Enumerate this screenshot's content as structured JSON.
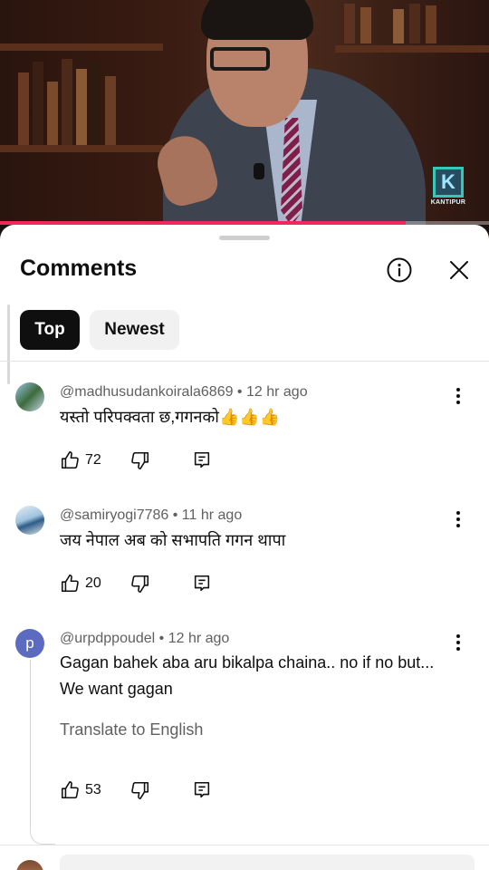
{
  "video": {
    "channel_logo_text": "KANTIPUR",
    "progress_fraction": 0.83
  },
  "sheet": {
    "title": "Comments",
    "filters": [
      {
        "label": "Top",
        "selected": true
      },
      {
        "label": "Newest",
        "selected": false
      }
    ]
  },
  "comments": [
    {
      "author": "@madhusudankoirala6869",
      "time": "12 hr ago",
      "meta": "@madhusudankoirala6869 • 12 hr ago",
      "text": "यस्तो परिपक्वता छ,गगनको👍👍👍",
      "likes": "72"
    },
    {
      "author": "@samiryogi7786",
      "time": "11 hr ago",
      "meta": "@samiryogi7786 • 11 hr ago",
      "text": "जय नेपाल अब को सभापति गगन थापा",
      "likes": "20"
    },
    {
      "author": "@urpdppoudel",
      "time": "12 hr ago",
      "meta": "@urpdppoudel • 12 hr ago",
      "avatar_letter": "p",
      "avatar_color": "#5c6bc0",
      "text": "Gagan bahek aba aru bikalpa chaina.. no if no but... We want gagan",
      "translate_label": "Translate to English",
      "likes": "53"
    }
  ],
  "colors": {
    "progress": "#f0285c",
    "chip_active_bg": "#0f0f0f",
    "chip_inactive_bg": "#f1f1f1"
  },
  "icons": {
    "info": "info-icon",
    "close": "close-icon",
    "like": "thumbs-up-icon",
    "dislike": "thumbs-down-icon",
    "reply": "reply-icon",
    "more": "more-vert-icon"
  }
}
